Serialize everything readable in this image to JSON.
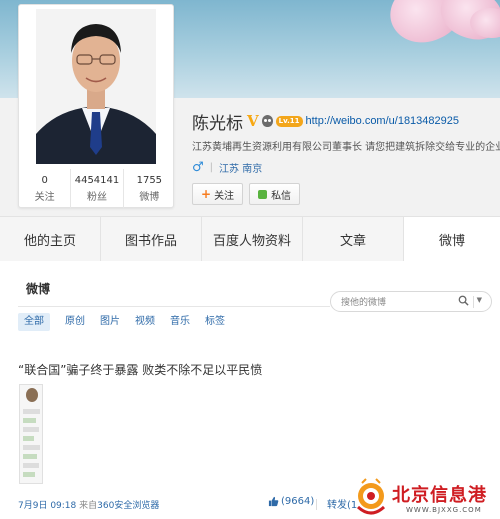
{
  "profile": {
    "name": "陈光标",
    "verified_mark": "V",
    "level_badge": "Lv.11",
    "url": "http://weibo.com/u/1813482925",
    "bio": "江苏黄埔再生资源利用有限公司董事长 请您把建筑拆除交给专业的企业",
    "location": "江苏 南京",
    "stats": [
      {
        "value": "0",
        "label": "关注"
      },
      {
        "value": "4454141",
        "label": "粉丝"
      },
      {
        "value": "1755",
        "label": "微博"
      }
    ],
    "follow_label": "关注",
    "message_label": "私信"
  },
  "tabs": [
    "他的主页",
    "图书作品",
    "百度人物资料",
    "文章",
    "微博"
  ],
  "feed": {
    "title": "微博",
    "search_placeholder": "搜他的微博",
    "filters": [
      "全部",
      "原创",
      "图片",
      "视频",
      "音乐",
      "标签"
    ],
    "post": {
      "text": "“联合国”骗子终于暴露 败类不除不足以平民愤",
      "time": "7月9日 09:18",
      "source_prefix": "来自",
      "source": "360安全浏览器",
      "likes": "(9664)",
      "forward": "转发(1"
    }
  },
  "watermark": {
    "name": "北京信息港",
    "url": "WWW.BJXXG.COM"
  },
  "colors": {
    "link": "#2e6aa8",
    "accent": "#f7a813",
    "watermark": "#cf1d22"
  }
}
